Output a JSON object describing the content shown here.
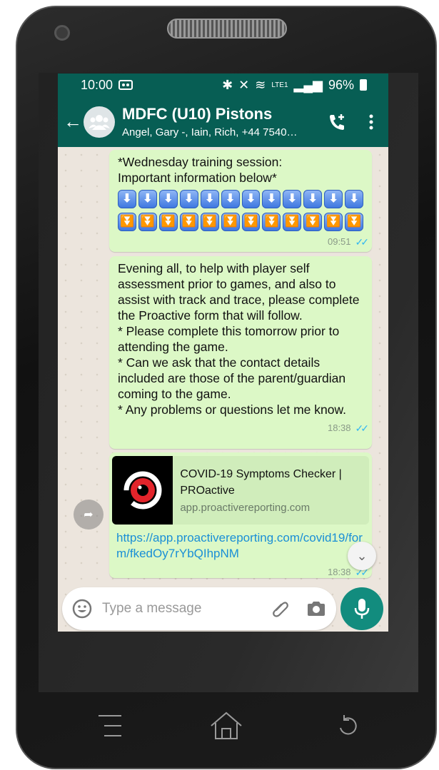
{
  "status_bar": {
    "time": "10:00",
    "network": "LTE1",
    "battery": "96%"
  },
  "header": {
    "back_icon": "arrow-left",
    "title": "MDFC (U10) Pistons",
    "subtitle": "Angel, Gary -, Iain, Rich, +44 7540…",
    "call_icon": "phone-plus",
    "menu_icon": "vertical-dots"
  },
  "messages": [
    {
      "text": "*Wednesday training session: Important information below*",
      "emoji_row_1": [
        "⬇",
        "⬇",
        "⬇",
        "⬇",
        "⬇",
        "⬇",
        "⬇",
        "⬇",
        "⬇",
        "⬇",
        "⬇",
        "⬇"
      ],
      "emoji_row_2": [
        "⏬",
        "⏬",
        "⏬",
        "⏬",
        "⏬",
        "⏬",
        "⏬",
        "⏬",
        "⏬",
        "⏬",
        "⏬",
        "⏬"
      ],
      "time": "09:51"
    },
    {
      "text": "Evening all, to help with player self assessment prior to games, and also to assist with track and trace, please complete the Proactive form that will follow.\n* Please complete this tomorrow prior to attending the game.\n* Can we ask that the contact details included are those of the parent/guardian coming to the game.\n* Any problems or questions let me know.",
      "time": "18:38"
    },
    {
      "link_title": "COVID-19 Symptoms Checker | PROactive",
      "link_domain": "app.proactivereporting.com",
      "url": "https://app.proactivereporting.com/covid19/form/fkedOy7rYbQIhpNM",
      "time": "18:38"
    }
  ],
  "composer": {
    "placeholder": "Type a message"
  },
  "colors": {
    "header": "#075e54",
    "bubble": "#dcf8c6",
    "accent": "#128c7e",
    "link": "#1a8fd6",
    "ticks": "#34b7f1"
  }
}
